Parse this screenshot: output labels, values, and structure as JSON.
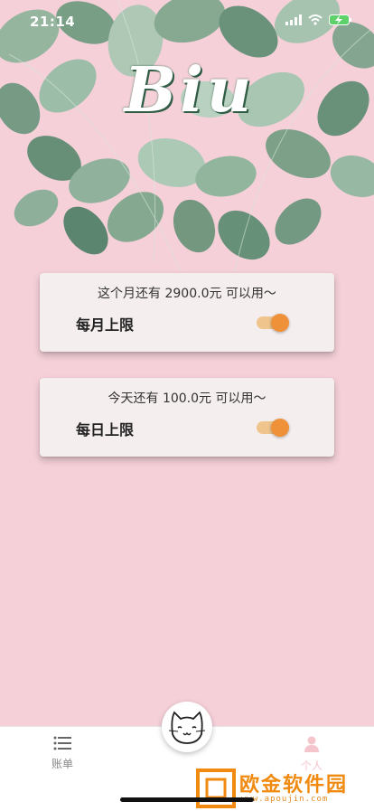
{
  "status_bar": {
    "time": "21:14"
  },
  "hero": {
    "logo_text": "Biu"
  },
  "cards": [
    {
      "info": "这个月还有 2900.0元 可以用～",
      "label": "每月上限",
      "toggle_on": true
    },
    {
      "info": "今天还有 100.0元 可以用～",
      "label": "每日上限",
      "toggle_on": true
    }
  ],
  "tabbar": {
    "bills_label": "账单",
    "me_label": "个人"
  },
  "watermark": {
    "text": "欧金软件园",
    "url": "www.apoujin.com"
  },
  "icons": {
    "signal": "signal-icon",
    "wifi": "wifi-icon",
    "battery": "battery-charging-icon",
    "list": "list-icon",
    "cat": "cat-face-icon",
    "person": "person-icon"
  },
  "colors": {
    "background": "#f5d0d9",
    "card": "#f4eeee",
    "toggle_track": "#efc48d",
    "toggle_thumb": "#ee9138",
    "tab_active": "#f5c5cc",
    "tab_inactive": "#888888"
  }
}
